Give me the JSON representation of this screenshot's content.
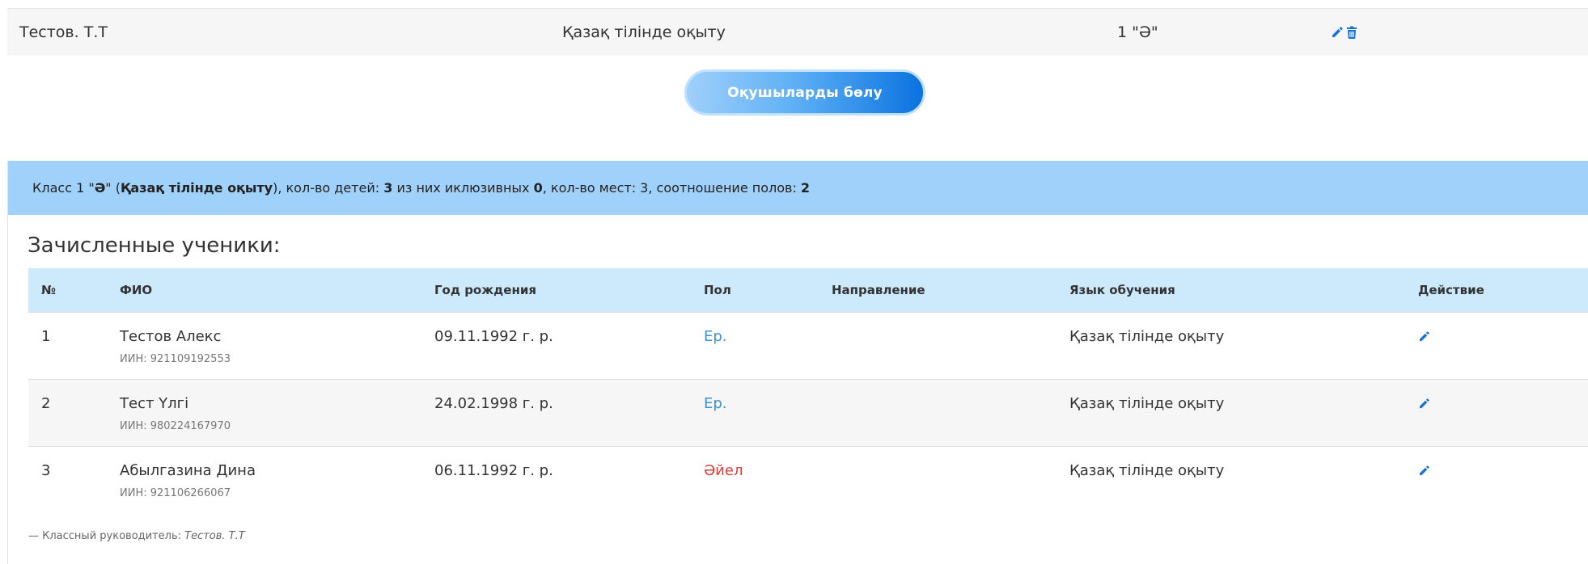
{
  "top_row": {
    "teacher": "Тестов. Т.Т",
    "language": "Қазақ тілінде оқыту",
    "class": "1 \"Ә\""
  },
  "distribute_button": {
    "label": "Оқушыларды бөлу"
  },
  "class_info": {
    "prefix": "Класс 1 \"",
    "letter": "Ә",
    "mid1": "\" (",
    "language": "Қазақ тілінде оқыту",
    "mid2": "), кол-во детей: ",
    "children_count": "3",
    "mid3": " из них иклюзивных ",
    "inclusive_count": "0",
    "mid4": ", кол-во мест: 3, соотношение полов: ",
    "gender_ratio": "2"
  },
  "section_title": "Зачисленные ученики:",
  "table": {
    "headers": {
      "num": "№",
      "fio": "ФИО",
      "year": "Год рождения",
      "sex": "Пол",
      "direction": "Направление",
      "language": "Язык обучения",
      "action": "Действие"
    },
    "rows": [
      {
        "num": "1",
        "name": "Тестов Алекс",
        "iin": "ИИН: 921109192553",
        "birth": "09.11.1992 г. р.",
        "sex": "Ер.",
        "direction": "",
        "language": "Қазақ тілінде оқыту"
      },
      {
        "num": "2",
        "name": "Тест Үлгі",
        "iin": "ИИН: 980224167970",
        "birth": "24.02.1998 г. р.",
        "sex": "Ер.",
        "direction": "",
        "language": "Қазақ тілінде оқыту"
      },
      {
        "num": "3",
        "name": "Абылгазина Дина",
        "iin": "ИИН: 921106266067",
        "birth": "06.11.1992 г. р.",
        "sex": "Әйел",
        "direction": "",
        "language": "Қазақ тілінде оқыту"
      }
    ]
  },
  "footer": {
    "prefix": "— Классный руководитель: ",
    "teacher": "Тестов. Т.Т"
  },
  "colors": {
    "accent_blue": "#0a73df",
    "header_blue": "#9fd1fb",
    "table_head_blue": "#cdeafd",
    "male_text": "#3a93d0",
    "female_text": "#d9413a"
  },
  "icons": {
    "edit": "pencil-icon",
    "delete": "trash-icon"
  }
}
